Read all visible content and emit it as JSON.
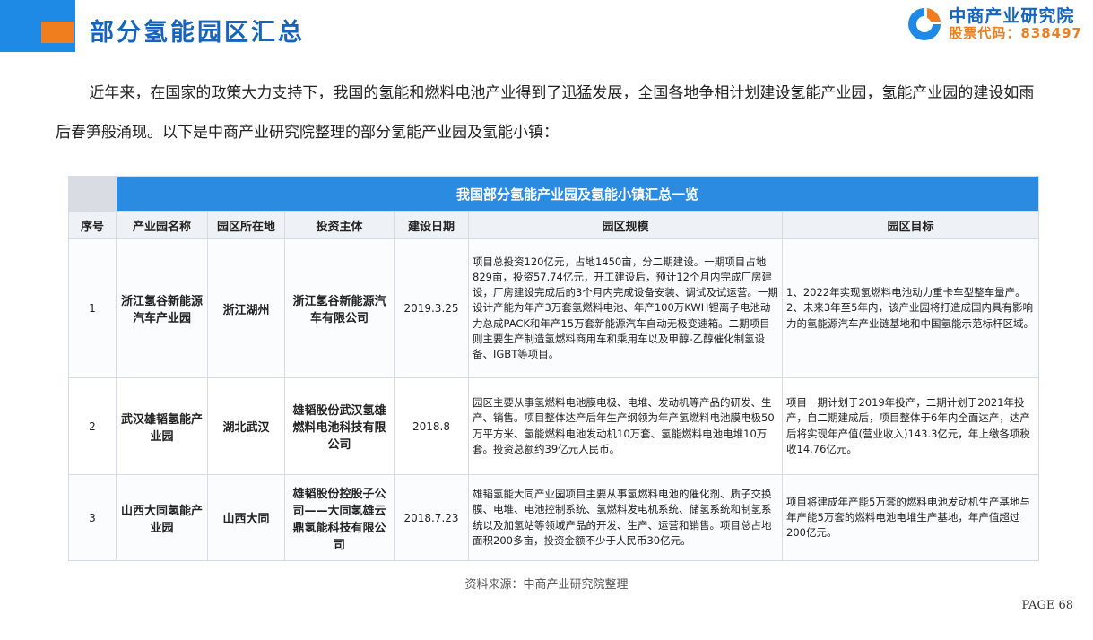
{
  "header": {
    "title": "部分氢能园区汇总",
    "logo_name": "中商产业研究院",
    "logo_code": "股票代码：838497"
  },
  "intro": "近年来，在国家的政策大力支持下，我国的氢能和燃料电池产业得到了迅猛发展，全国各地争相计划建设氢能产业园，氢能产业园的建设如雨后春笋般涌现。以下是中商产业研究院整理的部分氢能产业园及氢能小镇：",
  "table": {
    "title": "我国部分氢能产业园及氢能小镇汇总一览",
    "headers": [
      "序号",
      "产业园名称",
      "园区所在地",
      "投资主体",
      "建设日期",
      "园区规模",
      "园区目标"
    ],
    "rows": [
      {
        "no": "1",
        "name": "浙江氢谷新能源汽车产业园",
        "location": "浙江湖州",
        "investor": "浙江氢谷新能源汽车有限公司",
        "date": "2019.3.25",
        "scale": "项目总投资120亿元，占地1450亩，分二期建设。一期项目占地829亩，投资57.74亿元，开工建设后，预计12个月内完成厂房建设，厂房建设完成后的3个月内完成设备安装、调试及试运营。一期设计产能为年产3万套氢燃料电池、年产100万KWH锂离子电池动力总成PACK和年产15万套新能源汽车自动无极变速箱。二期项目则主要生产制造氢燃料商用车和乘用车以及甲醇-乙醇催化制氢设备、IGBT等项目。",
        "goal": "1、2022年实现氢燃料电池动力重卡车型整车量产。2、未来3年至5年内，该产业园将打造成国内具有影响力的氢能源汽车产业链基地和中国氢能示范标杆区域。"
      },
      {
        "no": "2",
        "name": "武汉雄韬氢能产业园",
        "location": "湖北武汉",
        "investor": "雄韬股份武汉氢雄燃料电池科技有限公司",
        "date": "2018.8",
        "scale": "园区主要从事氢燃料电池膜电极、电堆、发动机等产品的研发、生产、销售。项目整体达产后年生产纲领为年产氢燃料电池膜电极50万平方米、氢能燃料电池发动机10万套、氢能燃料电池电堆10万套。投资总额约39亿元人民币。",
        "goal": "项目一期计划于2019年投产，二期计划于2021年投产，自二期建成后，项目整体于6年内全面达产，达产后将实现年产值(营业收入)143.3亿元，年上缴各项税收14.76亿元。"
      },
      {
        "no": "3",
        "name": "山西大同氢能产业园",
        "location": "山西大同",
        "investor": "雄韬股份控股子公司——大同氢雄云鼎氢能科技有限公司",
        "date": "2018.7.23",
        "scale": "雄韬氢能大同产业园项目主要从事氢燃料电池的催化剂、质子交换膜、电堆、电池控制系统、氢燃料发电机系统、储氢系统和制氢系统以及加氢站等领域产品的开发、生产、运营和销售。项目总占地面积200多亩，投资金额不少于人民币30亿元。",
        "goal": "项目将建成年产能5万套的燃料电池发动机生产基地与年产能5万套的燃料电池电堆生产基地，年产值超过200亿元。"
      }
    ]
  },
  "source": "资料来源：中商产业研究院整理",
  "page": "PAGE 68",
  "colors": {
    "brand_blue": "#1e8ae6",
    "accent_orange": "#f07d1e",
    "title_blue": "#1565c0"
  }
}
